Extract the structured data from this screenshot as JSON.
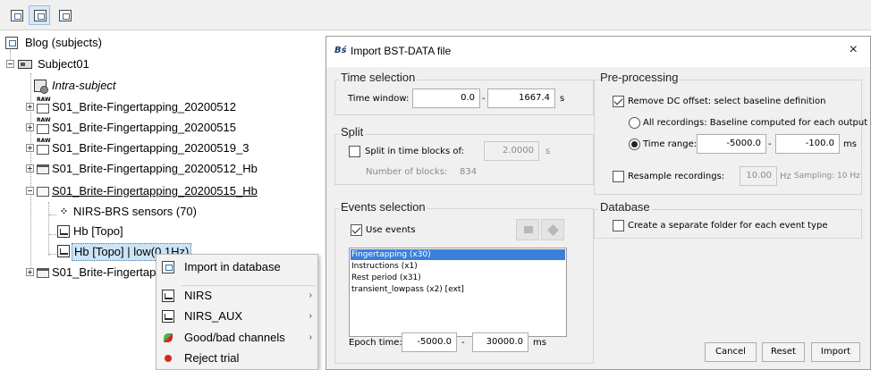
{
  "toolbar": {
    "buttons": [
      {
        "icon": "view-functional-icon"
      },
      {
        "icon": "view-anatomy-icon"
      },
      {
        "icon": "view-files-icon"
      }
    ]
  },
  "tree": {
    "root": "Blog (subjects)",
    "subject": "Subject01",
    "intra": "Intra-subject",
    "raw_folders": [
      "S01_Brite-Fingertapping_20200512",
      "S01_Brite-Fingertapping_20200515",
      "S01_Brite-Fingertapping_20200519_3"
    ],
    "folder_hb_1": "S01_Brite-Fingertapping_20200512_Hb",
    "folder_hb_2": "S01_Brite-Fingertapping_20200515_Hb",
    "sensors": "NIRS-BRS sensors (70)",
    "hb_topo": "Hb [Topo]",
    "hb_topo_low": "Hb [Topo] | low(0.1Hz)",
    "last_folder": "S01_Brite-Fingertapp"
  },
  "context_menu": {
    "items": [
      {
        "label": "Import in database",
        "submenu": false,
        "icon": "import-database-icon"
      },
      {
        "label": "NIRS",
        "submenu": true,
        "icon": "nirs-data-icon"
      },
      {
        "label": "NIRS_AUX",
        "submenu": true,
        "icon": "nirs-aux-icon"
      },
      {
        "label": "Good/bad channels",
        "submenu": true,
        "icon": "good-bad-channels-icon"
      },
      {
        "label": "Reject trial",
        "submenu": false,
        "icon": "reject-trial-icon"
      }
    ],
    "arrow": "›"
  },
  "dialog": {
    "logo": "Bś",
    "title": "Import BST-DATA file",
    "close": "×",
    "time_selection": {
      "title": "Time selection",
      "label": "Time window:",
      "start": "0.0",
      "dash": "-",
      "end": "1667.4",
      "unit": "s"
    },
    "split": {
      "title": "Split",
      "checkbox_label": "Split in time blocks of:",
      "value": "2.0000",
      "unit": "s",
      "blocks_label": "Number of blocks:",
      "blocks_value": "834"
    },
    "events": {
      "title": "Events selection",
      "use_label": "Use events",
      "list": [
        "Fingertapping (x30)",
        "Instructions (x1)",
        "Rest period (x31)",
        "transient_lowpass (x2)  [ext]"
      ],
      "epoch_label": "Epoch time:",
      "epoch_start": "-5000.0",
      "dash": "-",
      "epoch_end": "30000.0",
      "unit": "ms"
    },
    "preprocessing": {
      "title": "Pre-processing",
      "dc_label": "Remove DC offset: select baseline definition",
      "all_label": "All recordings: Baseline computed for each output file",
      "range_label": "Time range:",
      "range_start": "-5000.0",
      "dash": "-",
      "range_end": "-100.0",
      "unit": "ms",
      "resample_label": "Resample recordings:",
      "resample_value": "10.00",
      "resample_unit": "Hz",
      "sampling_info": "Sampling: 10 Hz"
    },
    "database": {
      "title": "Database",
      "folder_label": "Create a separate folder for each event type"
    },
    "buttons": {
      "cancel": "Cancel",
      "reset": "Reset",
      "import": "Import"
    }
  }
}
